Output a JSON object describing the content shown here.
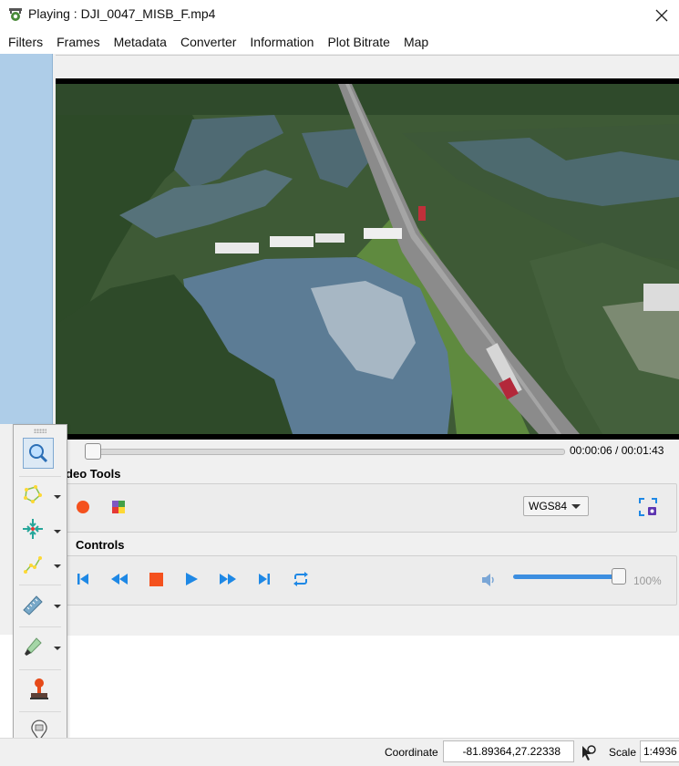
{
  "window": {
    "title": "Playing : DJI_0047_MISB_F.mp4"
  },
  "menu": [
    "Filters",
    "Frames",
    "Metadata",
    "Converter",
    "Information",
    "Plot Bitrate",
    "Map"
  ],
  "player": {
    "time": "00:00:06 / 00:01:43",
    "seek_progress": 0.06
  },
  "video_tools": {
    "title": "Video Tools",
    "crs": "WGS84"
  },
  "controls": {
    "title": "Controls",
    "volume": "100%",
    "volume_level": 1.0
  },
  "toolbar": {
    "tools": [
      "zoom-icon",
      "polygon-icon",
      "pan-to-center-icon",
      "line-icon",
      "measure-icon",
      "highlighter-icon",
      "stamp-icon",
      "pin-label-icon"
    ]
  },
  "statusbar": {
    "coordinate_label": "Coordinate",
    "coordinate_value": "-81.89364,27.22338",
    "scale_label": "Scale",
    "scale_value": "1:4936"
  },
  "colors": {
    "accent": "#1e88e5",
    "record": "#f4511e",
    "stop": "#f4511e",
    "sidebar": "#aecde8"
  }
}
